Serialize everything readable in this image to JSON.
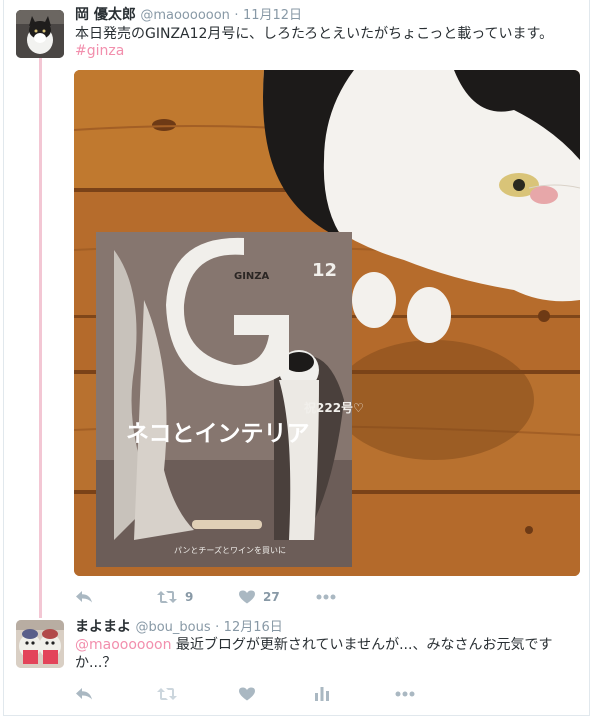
{
  "tweet1": {
    "name": "岡 優太郎",
    "handle": "@maoooooon",
    "separator": "·",
    "date": "11月12日",
    "text": "本日発売のGINZA12月号に、しろたろとえいたがちょこっと載っています。",
    "hashtag": "#ginza",
    "photo": {
      "magazine_title": "GINZA",
      "magazine_letter": "G",
      "magazine_issue": "12",
      "cover_headline": "ネコとインテリア",
      "cover_badge": "祝222号♡",
      "cover_sub": "パンとチーズとワインを買いに"
    },
    "retweet_count": "9",
    "like_count": "27"
  },
  "tweet2": {
    "name": "まよまよ",
    "handle": "@bou_bous",
    "separator": "·",
    "date": "12月16日",
    "mention": "@maoooooon",
    "text": " 最近ブログが更新されていませんが...、みなさんお元気ですか...？"
  },
  "icons": {
    "reply": "reply-icon",
    "retweet": "retweet-icon",
    "like": "heart-icon",
    "more": "more-icon",
    "analytics": "analytics-icon"
  },
  "colors": {
    "accent": "#f28fad",
    "thread": "#f3c7d4",
    "muted": "#8899a6"
  }
}
